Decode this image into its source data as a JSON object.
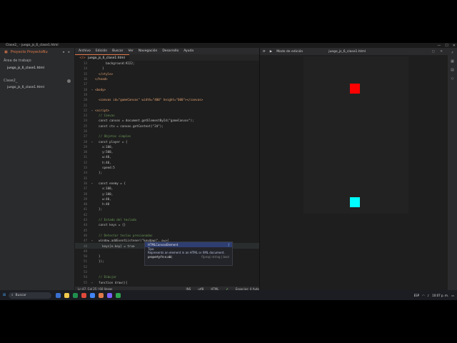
{
  "window": {
    "title": "Clase2_ - juego_js_6_clase1.html"
  },
  "left_panel": {
    "header": "Proyecto ProyectoNu",
    "section": "Área de trabajo",
    "open_files": [
      "juego_js_6_clase1.html"
    ],
    "project": "Clase2_",
    "project_files": [
      "juego_js_6_clase1.html"
    ]
  },
  "menu": [
    "Archivo",
    "Edición",
    "Buscar",
    "Ver",
    "Navegación",
    "Desarrollo",
    "Ayuda"
  ],
  "editor": {
    "tab": "juego_js_6_clase1.html",
    "lines": [
      {
        "n": "13",
        "f": "",
        "t": "      background:#222;"
      },
      {
        "n": "14",
        "f": "",
        "t": "    }"
      },
      {
        "n": "15",
        "f": "",
        "t": "  </style>"
      },
      {
        "n": "16",
        "f": "",
        "t": "</head>"
      },
      {
        "n": "17",
        "f": "",
        "t": ""
      },
      {
        "n": "18",
        "f": "▾",
        "t": "<body>"
      },
      {
        "n": "19",
        "f": "",
        "t": ""
      },
      {
        "n": "20",
        "f": "",
        "t": "  <canvas id=\"gameCanvas\" width=\"400\" height=\"600\"></canvas>"
      },
      {
        "n": "21",
        "f": "",
        "t": ""
      },
      {
        "n": "22",
        "f": "▾",
        "t": "<script>"
      },
      {
        "n": "23",
        "f": "",
        "t": "  // Canvas"
      },
      {
        "n": "24",
        "f": "",
        "t": "  const canvas = document.getElementById(\"gameCanvas\");"
      },
      {
        "n": "25",
        "f": "",
        "t": "  const ctx = canvas.getContext(\"2d\");"
      },
      {
        "n": "26",
        "f": "",
        "t": ""
      },
      {
        "n": "27",
        "f": "",
        "t": "  // Objetos simples"
      },
      {
        "n": "28",
        "f": "▾",
        "t": "  const player = {"
      },
      {
        "n": "29",
        "f": "",
        "t": "    x:100,"
      },
      {
        "n": "30",
        "f": "",
        "t": "    y:500,"
      },
      {
        "n": "31",
        "f": "",
        "t": "    w:40,"
      },
      {
        "n": "32",
        "f": "",
        "t": "    h:40,"
      },
      {
        "n": "33",
        "f": "",
        "t": "    speed:5"
      },
      {
        "n": "34",
        "f": "",
        "t": "  };"
      },
      {
        "n": "35",
        "f": "",
        "t": ""
      },
      {
        "n": "36",
        "f": "▾",
        "t": "  const enemy = {"
      },
      {
        "n": "37",
        "f": "",
        "t": "    x:100,"
      },
      {
        "n": "38",
        "f": "",
        "t": "    y:100,"
      },
      {
        "n": "39",
        "f": "",
        "t": "    w:40,"
      },
      {
        "n": "40",
        "f": "",
        "t": "    h:40"
      },
      {
        "n": "41",
        "f": "",
        "t": "  };"
      },
      {
        "n": "42",
        "f": "",
        "t": ""
      },
      {
        "n": "43",
        "f": "",
        "t": "  // Estado del teclado"
      },
      {
        "n": "44",
        "f": "",
        "t": "  const keys = {}"
      },
      {
        "n": "45",
        "f": "",
        "t": ""
      },
      {
        "n": "46",
        "f": "",
        "t": "  // Detectar teclas presionadas"
      },
      {
        "n": "47",
        "f": "▾",
        "t": "  window.addEventListener(\"keydown\", e=>{"
      },
      {
        "n": "48",
        "f": "",
        "t": "    keys[e.key] = true"
      },
      {
        "n": "49",
        "f": "",
        "t": ""
      },
      {
        "n": "50",
        "f": "",
        "t": "  }"
      },
      {
        "n": "51",
        "f": "",
        "t": "  });"
      },
      {
        "n": "52",
        "f": "",
        "t": ""
      },
      {
        "n": "53",
        "f": "",
        "t": ""
      },
      {
        "n": "54",
        "f": "",
        "t": "  // Dibujar"
      },
      {
        "n": "55",
        "f": "▾",
        "t": "  function draw(){"
      },
      {
        "n": "56",
        "f": "",
        "t": "    ctx.clearRect(0,0,canvas.width,canvas.height);"
      },
      {
        "n": "57",
        "f": "",
        "t": ""
      },
      {
        "n": "58",
        "f": "",
        "t": "    ctx.fillStyle = \"cyan\";"
      }
    ],
    "current_line_index": 35
  },
  "hint": {
    "item1": "HTMLCanvasElement",
    "item1_tag": "Tipo",
    "desc": "Represents an element in an HTML or XML document.",
    "item2": "property:fn:e.abl;",
    "item2_tag": "f(prop) string | bool"
  },
  "status": {
    "pos": "Ln 47, Col 25 | 60 líneas",
    "ins": "INS",
    "enc": "utf8",
    "lang": "HTML",
    "spaces": "Espacios: 4 Auto"
  },
  "preview": {
    "mode": "Modo de edición",
    "file": "juego_js_6_clase1.html"
  },
  "taskbar": {
    "search": "Buscar",
    "time": "10:07 p. m.",
    "date": "",
    "lang": "ESP"
  },
  "colors": {
    "player": "#ff0000",
    "enemy": "#00ffff",
    "accent": "#e07a4a"
  }
}
